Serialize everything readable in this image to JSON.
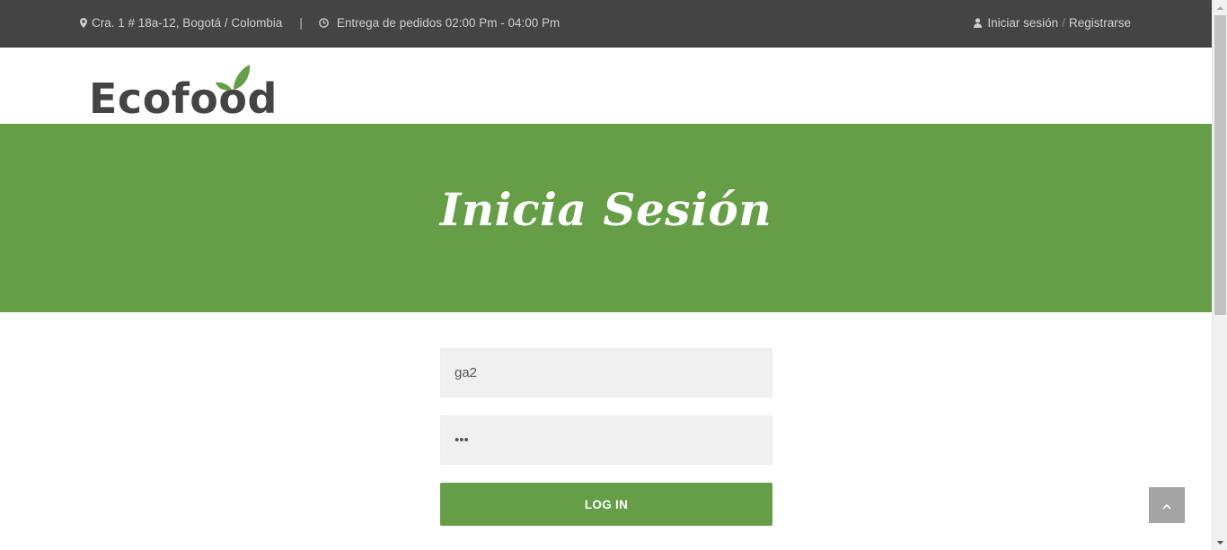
{
  "topbar": {
    "address": "Cra. 1 # 18a-12, Bogotá / Colombia",
    "separator": "|",
    "delivery": "Entrega de pedidos 02:00 Pm - 04:00 Pm",
    "login_link": "Iniciar sesión",
    "slash": "/",
    "register_link": "Registrarse",
    "icons": [
      "map-pin-icon",
      "clock-icon",
      "user-icon"
    ]
  },
  "header": {
    "logo_text": "Ecofood",
    "logo_icon": "leaf-icon"
  },
  "banner": {
    "title": "Inicia Sesión"
  },
  "form": {
    "username_value": "ga2",
    "password_value": "123",
    "submit_label": "LOG IN"
  },
  "back_to_top": {
    "icon": "chevron-up-icon"
  },
  "colors": {
    "topbar_bg": "#444444",
    "brand_green": "#659e47",
    "logo_text": "#444444",
    "input_bg": "#f0f0f0",
    "back_to_top_bg": "#a4a4a4"
  }
}
